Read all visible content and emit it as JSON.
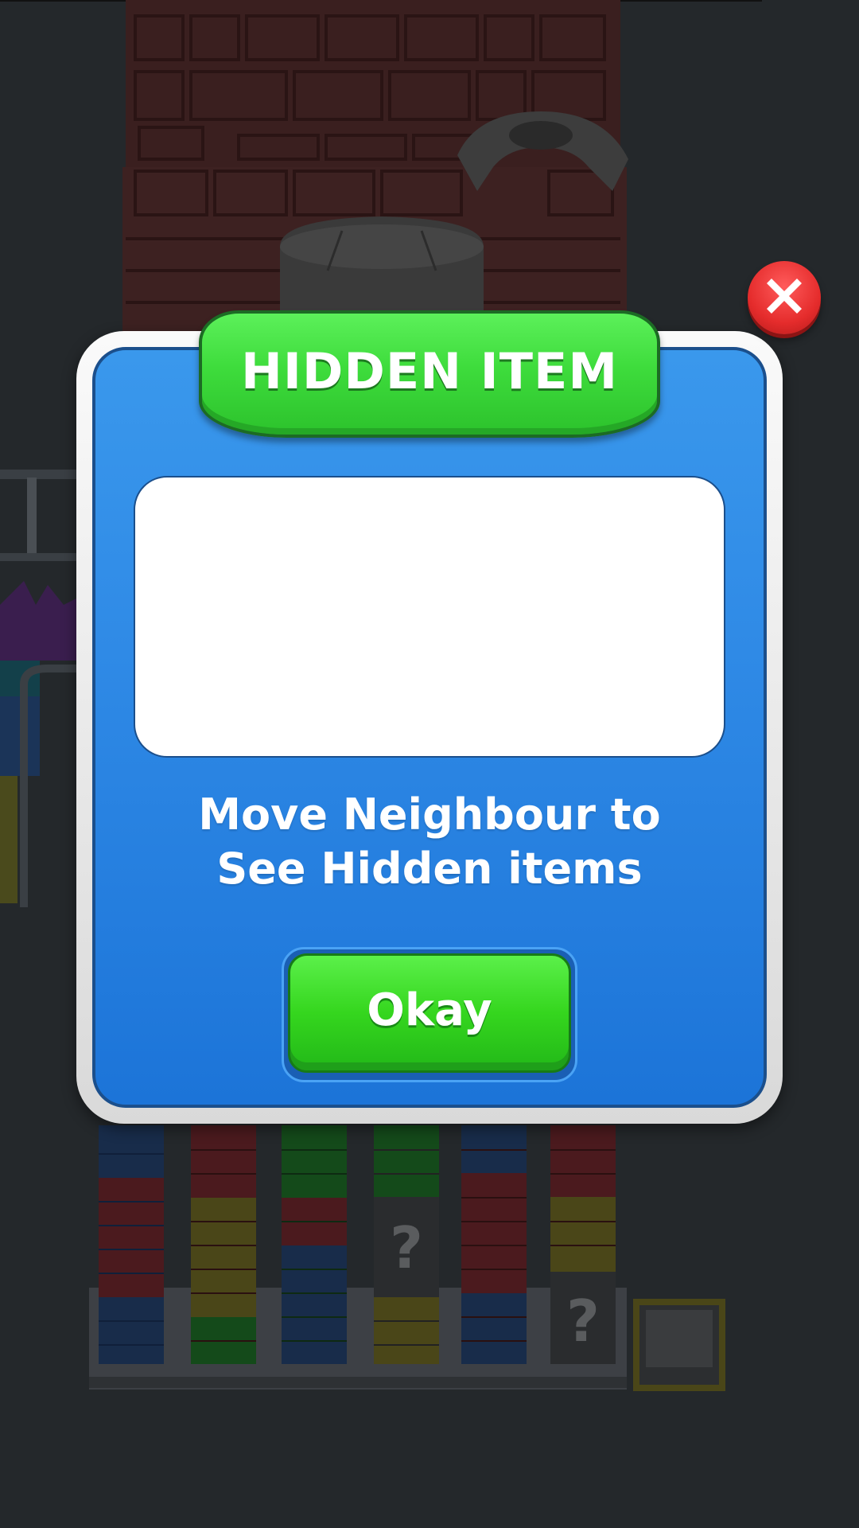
{
  "dialog": {
    "title": "HIDDEN ITEM",
    "message_line1": "Move Neighbour to",
    "message_line2": "See Hidden items",
    "okay_label": "Okay"
  },
  "board": {
    "hidden_marker": "?"
  },
  "colors": {
    "panel_blue": "#2f8ae6",
    "banner_green": "#3edc3c",
    "button_green": "#35d61e",
    "close_red": "#e52c2c",
    "backdrop": "#24282b"
  },
  "icons": {
    "close": "close-icon"
  }
}
